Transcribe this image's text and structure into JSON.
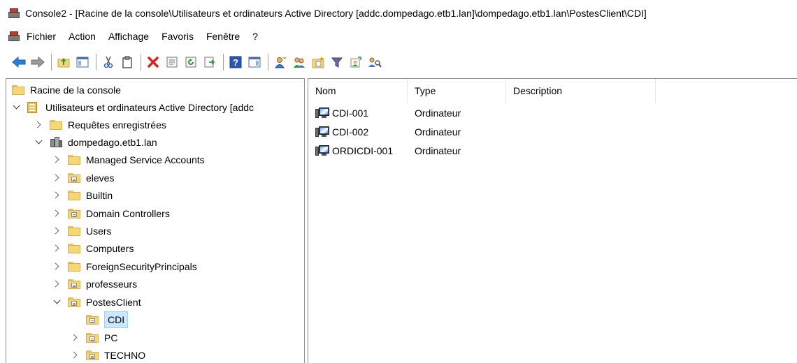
{
  "window": {
    "title": "Console2 - [Racine de la console\\Utilisateurs et ordinateurs Active Directory [addc.dompedago.etb1.lan]\\dompedago.etb1.lan\\PostesClient\\CDI]"
  },
  "menu": {
    "items": [
      "Fichier",
      "Action",
      "Affichage",
      "Favoris",
      "Fenêtre",
      "?"
    ]
  },
  "toolbar": {
    "icons": [
      "back-arrow-icon",
      "forward-arrow-icon",
      "up-folder-icon",
      "show-hide-tree-icon",
      "cut-icon",
      "copy-icon",
      "delete-icon",
      "properties-icon",
      "refresh-icon",
      "export-list-icon",
      "help-icon",
      "show-hide-action-pane-icon",
      "new-user-icon",
      "new-group-icon",
      "new-ou-icon",
      "filter-icon",
      "add-to-group-icon",
      "find-icon"
    ]
  },
  "tree": {
    "items": [
      {
        "label": "Racine de la console",
        "icon": "folder-icon",
        "expander": "none"
      },
      {
        "label": "Utilisateurs et ordinateurs Active Directory [addc",
        "icon": "ad-snapin-icon",
        "expander": "expanded"
      },
      {
        "label": "Requêtes enregistrées",
        "icon": "folder-icon",
        "expander": "collapsed"
      },
      {
        "label": "dompedago.etb1.lan",
        "icon": "domain-icon",
        "expander": "expanded"
      },
      {
        "label": "Managed Service Accounts",
        "icon": "folder-icon",
        "expander": "collapsed"
      },
      {
        "label": "eleves",
        "icon": "ou-icon",
        "expander": "collapsed"
      },
      {
        "label": "Builtin",
        "icon": "folder-icon",
        "expander": "collapsed"
      },
      {
        "label": "Domain Controllers",
        "icon": "ou-icon",
        "expander": "collapsed"
      },
      {
        "label": "Users",
        "icon": "folder-icon",
        "expander": "collapsed"
      },
      {
        "label": "Computers",
        "icon": "folder-icon",
        "expander": "collapsed"
      },
      {
        "label": "ForeignSecurityPrincipals",
        "icon": "folder-icon",
        "expander": "collapsed"
      },
      {
        "label": "professeurs",
        "icon": "ou-icon",
        "expander": "collapsed"
      },
      {
        "label": "PostesClient",
        "icon": "ou-icon",
        "expander": "expanded"
      },
      {
        "label": "CDI",
        "icon": "ou-icon",
        "expander": "none",
        "selected": true
      },
      {
        "label": "PC",
        "icon": "ou-icon",
        "expander": "collapsed"
      },
      {
        "label": "TECHNO",
        "icon": "ou-icon",
        "expander": "collapsed"
      }
    ]
  },
  "list": {
    "columns": [
      "Nom",
      "Type",
      "Description"
    ],
    "rows": [
      {
        "name": "CDI-001",
        "type": "Ordinateur",
        "description": "",
        "icon": "computer-icon"
      },
      {
        "name": "CDI-002",
        "type": "Ordinateur",
        "description": "",
        "icon": "computer-icon"
      },
      {
        "name": "ORDICDI-001",
        "type": "Ordinateur",
        "description": "",
        "icon": "computer-icon"
      }
    ]
  },
  "colors": {
    "selection_bg": "#cce8ff",
    "selection_border": "#99d1ff",
    "pane_border": "#8c8c8c"
  }
}
